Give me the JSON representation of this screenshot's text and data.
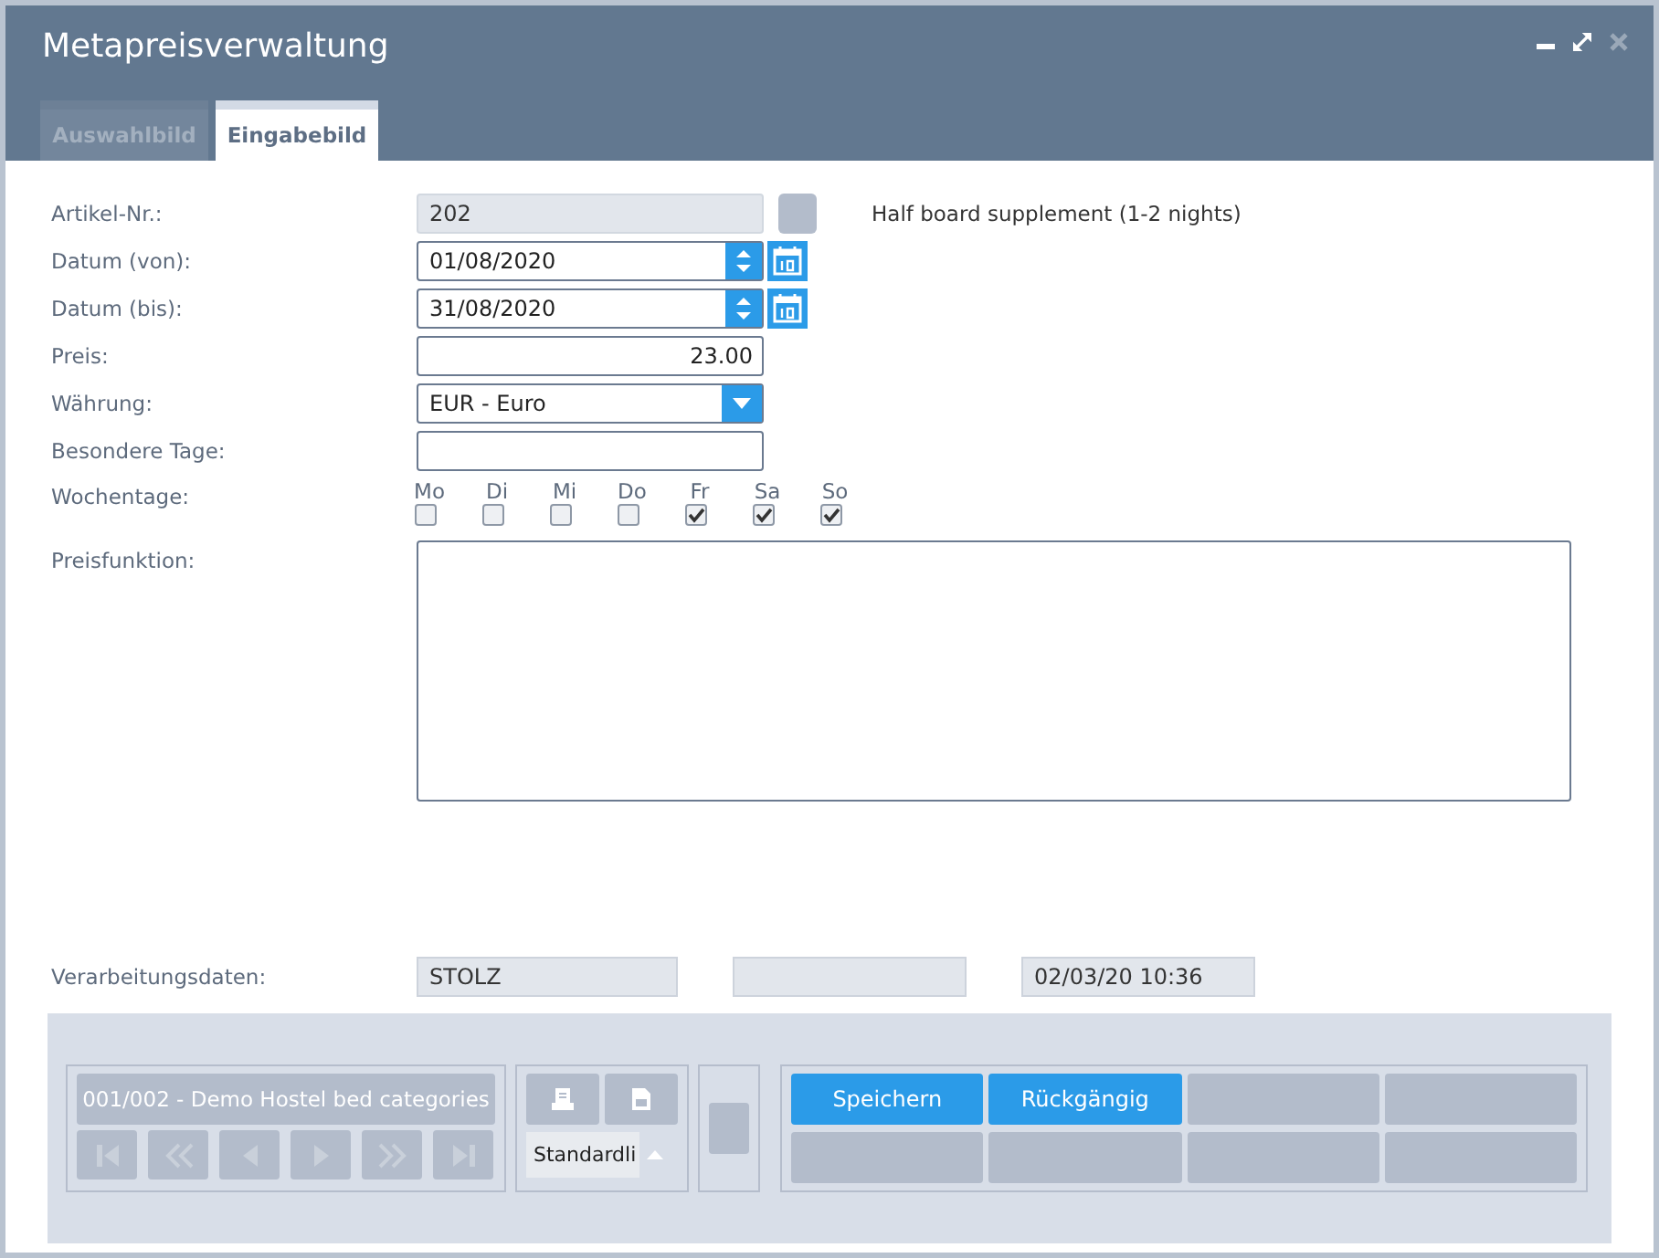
{
  "window": {
    "title": "Metapreisverwaltung"
  },
  "tabs": [
    {
      "label": "Auswahlbild",
      "selected": false
    },
    {
      "label": "Eingabebild",
      "selected": true
    }
  ],
  "form": {
    "fields": [
      {
        "label": "Artikel-Nr.:",
        "kind": "readonly",
        "value": "202",
        "note": "Half board supplement (1-2 nights)"
      },
      {
        "label": "Datum (von):",
        "kind": "date",
        "value": "01/08/2020"
      },
      {
        "label": "Datum (bis):",
        "kind": "date",
        "value": "31/08/2020"
      },
      {
        "label": "Preis:",
        "kind": "number",
        "value": "23.00"
      },
      {
        "label": "Währung:",
        "kind": "select",
        "value": "EUR - Euro"
      },
      {
        "label": "Besondere Tage:",
        "kind": "text"
      },
      {
        "label": "Wochentage:",
        "kind": "weekdays",
        "days": [
          {
            "label": "Mo",
            "checked": false
          },
          {
            "label": "Di",
            "checked": false
          },
          {
            "label": "Mi",
            "checked": false
          },
          {
            "label": "Do",
            "checked": false
          },
          {
            "label": "Fr",
            "checked": true
          },
          {
            "label": "Sa",
            "checked": true
          },
          {
            "label": "So",
            "checked": true
          }
        ]
      },
      {
        "label": "Preisfunktion:",
        "kind": "textarea"
      }
    ]
  },
  "processing": {
    "label": "Verarbeitungsdaten:",
    "fields": [
      {
        "kind": "user",
        "value": "STOLZ"
      },
      {
        "kind": "blank"
      },
      {
        "kind": "timestamp",
        "value": "02/03/20 10:36"
      }
    ]
  },
  "footer": {
    "record": "001/002 - Demo Hostel bed categories",
    "nav": [
      {
        "kind": "first"
      },
      {
        "kind": "rewind"
      },
      {
        "kind": "prev"
      },
      {
        "kind": "next"
      },
      {
        "kind": "forward"
      },
      {
        "kind": "last"
      }
    ],
    "report": "Standardli",
    "actions": [
      {
        "kind": "button",
        "label": "Speichern"
      },
      {
        "kind": "button",
        "label": "Rückgängig"
      },
      {
        "kind": "empty"
      },
      {
        "kind": "empty"
      },
      {
        "kind": "empty"
      },
      {
        "kind": "empty"
      },
      {
        "kind": "empty"
      },
      {
        "kind": "empty"
      }
    ]
  }
}
